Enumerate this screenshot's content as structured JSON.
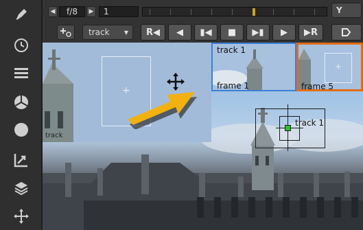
{
  "toolbar": {
    "frame_display": "f/8",
    "frame_number": "1",
    "track_mode": "track",
    "y_label": "Y"
  },
  "viewer": {
    "zoom_window_label": "track",
    "thumb_a": {
      "title": "track 1",
      "caption": "frame 1"
    },
    "thumb_b": {
      "caption": "frame 5"
    },
    "tracker_label": "track 1"
  },
  "colors": {
    "arrow": "#f2b10d",
    "thumb_a_border": "#3b7fd6",
    "thumb_b_border": "#e46d12",
    "tracker_center": "#27c52c"
  },
  "icons": {
    "sidebar": [
      "pen-icon",
      "clock-icon",
      "layers-menu-icon",
      "color-wheel-icon",
      "circle-icon",
      "graph-edit-icon",
      "stack-icon",
      "move-icon"
    ]
  }
}
